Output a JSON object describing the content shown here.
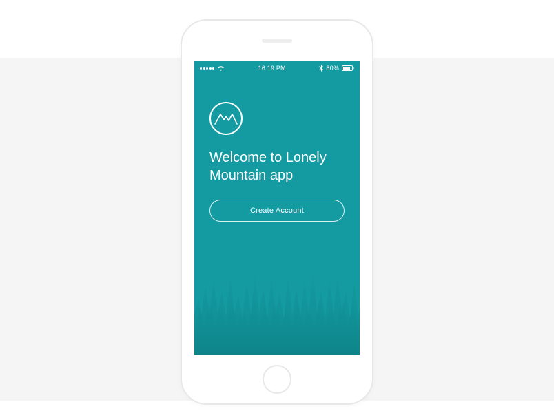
{
  "status_bar": {
    "time": "16:19 PM",
    "battery_text": "80%"
  },
  "app": {
    "welcome_title": "Welcome to Lonely Mountain app",
    "create_account_label": "Create Account"
  },
  "colors": {
    "accent": "#149ba1"
  }
}
